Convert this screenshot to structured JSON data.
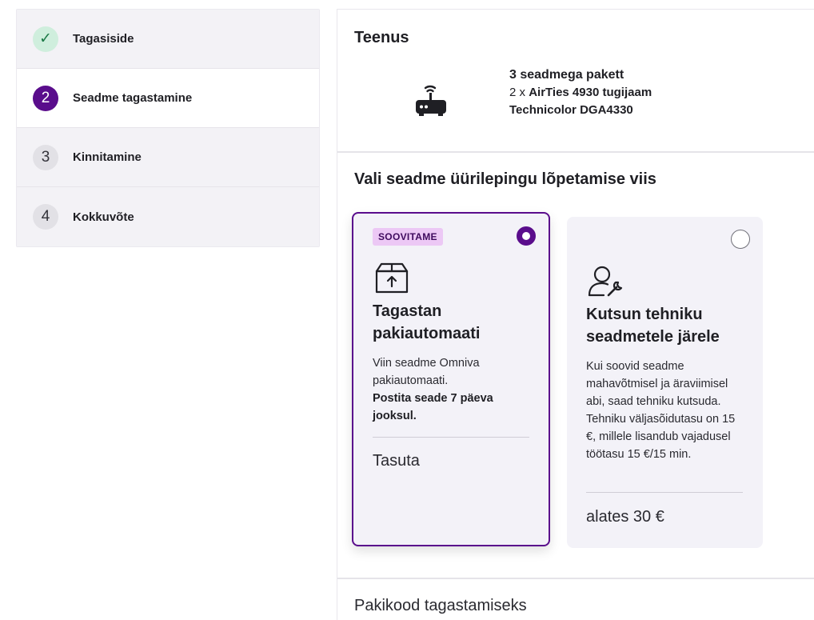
{
  "steps": [
    {
      "number": "✓",
      "label": "Tagasiside",
      "state": "done"
    },
    {
      "number": "2",
      "label": "Seadme tagastamine",
      "state": "current"
    },
    {
      "number": "3",
      "label": "Kinnitamine",
      "state": "todo"
    },
    {
      "number": "4",
      "label": "Kokkuvõte",
      "state": "todo"
    }
  ],
  "service": {
    "title": "Teenus",
    "icon": "router-icon",
    "package_name": "3 seadmega pakett",
    "line1_prefix": "2 x ",
    "line1_bold": "AirTies 4930 tugijaam",
    "line2": "Technicolor DGA4330"
  },
  "choose": {
    "title": "Vali seadme üürilepingu lõpetamise viis",
    "options": [
      {
        "tag": "SOOVITAME",
        "icon": "package-return-icon",
        "title": "Tagastan pakiautomaati",
        "desc": "Viin seadme Omniva pakiautomaati.",
        "desc_bold": "Postita seade 7 päeva jooksul.",
        "price": "Tasuta",
        "selected": true
      },
      {
        "icon": "technician-icon",
        "title": "Kutsun tehniku seadmetele järele",
        "desc": "Kui soovid seadme mahavõtmisel ja äraviimisel abi, saad tehniku kutsuda. Tehniku väljasõidutasu on 15 €, millele lisandub vajadusel töötasu 15 €/15 min.",
        "price": "alates 30 €",
        "selected": false
      }
    ]
  },
  "code_section": {
    "title": "Pakikood tagastamiseks"
  },
  "colors": {
    "brand": "#5a0d8c",
    "tag_bg": "#ecc8f5",
    "done_bg": "#cfeedd",
    "card_bg": "#f3f2f8"
  }
}
